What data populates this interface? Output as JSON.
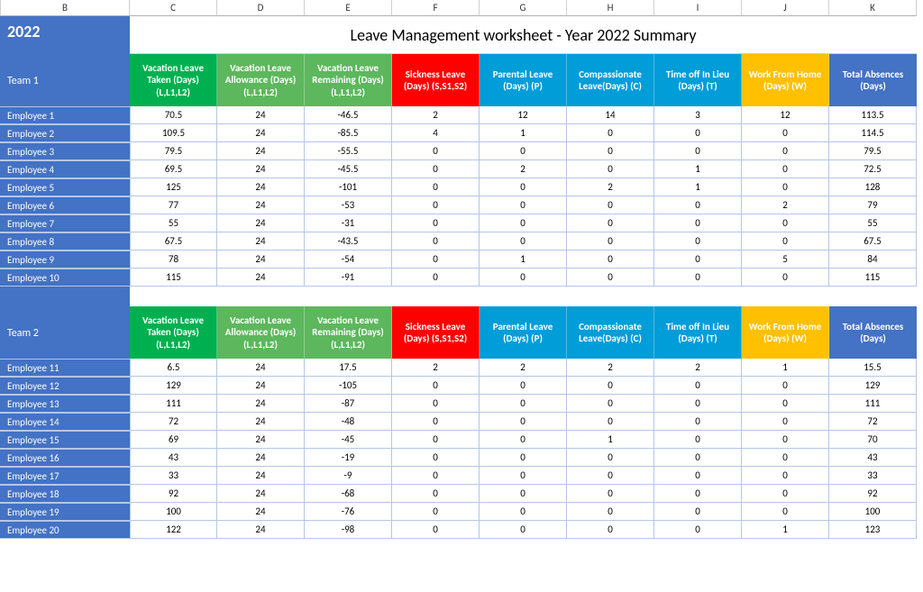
{
  "year": "2022",
  "title": "Leave Management worksheet - Year 2022 Summary",
  "col_letters": [
    "B",
    "C",
    "D",
    "E",
    "F",
    "G",
    "H",
    "I",
    "J",
    "K"
  ],
  "headers": [
    "Vacation Leave Taken (Days) (L,L1,L2)",
    "Vacation Leave Allowance (Days) (L,L1,L2)",
    "Vacation Leave Remaining (Days) (L,L1,L2)",
    "Sickness Leave (Days) (S,S1,S2)",
    "Parental Leave (Days) (P)",
    "Compassionate Leave(Days) (C)",
    "Time off In Lieu (Days) (T)",
    "Work From Home (Days) (W)",
    "Total Absences (Days)"
  ],
  "header_classes": [
    "green1",
    "green2",
    "green3",
    "red",
    "blue1",
    "blue2",
    "blue3",
    "yellow",
    "blue4"
  ],
  "teams": [
    {
      "name": "Team 1",
      "rows": [
        {
          "emp": "Employee 1",
          "vals": [
            "70.5",
            "24",
            "-46.5",
            "2",
            "12",
            "14",
            "3",
            "12",
            "113.5"
          ]
        },
        {
          "emp": "Employee 2",
          "vals": [
            "109.5",
            "24",
            "-85.5",
            "4",
            "1",
            "0",
            "0",
            "0",
            "114.5"
          ]
        },
        {
          "emp": "Employee 3",
          "vals": [
            "79.5",
            "24",
            "-55.5",
            "0",
            "0",
            "0",
            "0",
            "0",
            "79.5"
          ]
        },
        {
          "emp": "Employee 4",
          "vals": [
            "69.5",
            "24",
            "-45.5",
            "0",
            "2",
            "0",
            "1",
            "0",
            "72.5"
          ]
        },
        {
          "emp": "Employee 5",
          "vals": [
            "125",
            "24",
            "-101",
            "0",
            "0",
            "2",
            "1",
            "0",
            "128"
          ]
        },
        {
          "emp": "Employee 6",
          "vals": [
            "77",
            "24",
            "-53",
            "0",
            "0",
            "0",
            "0",
            "2",
            "79"
          ]
        },
        {
          "emp": "Employee 7",
          "vals": [
            "55",
            "24",
            "-31",
            "0",
            "0",
            "0",
            "0",
            "0",
            "55"
          ]
        },
        {
          "emp": "Employee 8",
          "vals": [
            "67.5",
            "24",
            "-43.5",
            "0",
            "0",
            "0",
            "0",
            "0",
            "67.5"
          ]
        },
        {
          "emp": "Employee 9",
          "vals": [
            "78",
            "24",
            "-54",
            "0",
            "1",
            "0",
            "0",
            "5",
            "84"
          ]
        },
        {
          "emp": "Employee 10",
          "vals": [
            "115",
            "24",
            "-91",
            "0",
            "0",
            "0",
            "0",
            "0",
            "115"
          ]
        }
      ]
    },
    {
      "name": "Team 2",
      "rows": [
        {
          "emp": "Employee 11",
          "vals": [
            "6.5",
            "24",
            "17.5",
            "2",
            "2",
            "2",
            "2",
            "1",
            "15.5"
          ]
        },
        {
          "emp": "Employee 12",
          "vals": [
            "129",
            "24",
            "-105",
            "0",
            "0",
            "0",
            "0",
            "0",
            "129"
          ]
        },
        {
          "emp": "Employee 13",
          "vals": [
            "111",
            "24",
            "-87",
            "0",
            "0",
            "0",
            "0",
            "0",
            "111"
          ]
        },
        {
          "emp": "Employee 14",
          "vals": [
            "72",
            "24",
            "-48",
            "0",
            "0",
            "0",
            "0",
            "0",
            "72"
          ]
        },
        {
          "emp": "Employee 15",
          "vals": [
            "69",
            "24",
            "-45",
            "0",
            "0",
            "1",
            "0",
            "0",
            "70"
          ]
        },
        {
          "emp": "Employee 16",
          "vals": [
            "43",
            "24",
            "-19",
            "0",
            "0",
            "0",
            "0",
            "0",
            "43"
          ]
        },
        {
          "emp": "Employee 17",
          "vals": [
            "33",
            "24",
            "-9",
            "0",
            "0",
            "0",
            "0",
            "0",
            "33"
          ]
        },
        {
          "emp": "Employee 18",
          "vals": [
            "92",
            "24",
            "-68",
            "0",
            "0",
            "0",
            "0",
            "0",
            "92"
          ]
        },
        {
          "emp": "Employee 19",
          "vals": [
            "100",
            "24",
            "-76",
            "0",
            "0",
            "0",
            "0",
            "0",
            "100"
          ]
        },
        {
          "emp": "Employee 20",
          "vals": [
            "122",
            "24",
            "-98",
            "0",
            "0",
            "0",
            "0",
            "1",
            "123"
          ]
        }
      ]
    }
  ]
}
